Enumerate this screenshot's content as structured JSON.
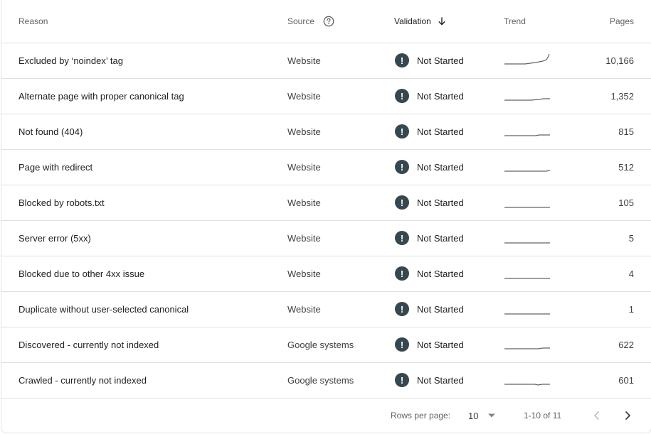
{
  "header": {
    "reason": "Reason",
    "source": "Source",
    "validation": "Validation",
    "trend": "Trend",
    "pages": "Pages"
  },
  "rows": [
    {
      "reason": "Excluded by ‘noindex’ tag",
      "source": "Website",
      "status": "Not Started",
      "pages": "10,166"
    },
    {
      "reason": "Alternate page with proper canonical tag",
      "source": "Website",
      "status": "Not Started",
      "pages": "1,352"
    },
    {
      "reason": "Not found (404)",
      "source": "Website",
      "status": "Not Started",
      "pages": "815"
    },
    {
      "reason": "Page with redirect",
      "source": "Website",
      "status": "Not Started",
      "pages": "512"
    },
    {
      "reason": "Blocked by robots.txt",
      "source": "Website",
      "status": "Not Started",
      "pages": "105"
    },
    {
      "reason": "Server error (5xx)",
      "source": "Website",
      "status": "Not Started",
      "pages": "5"
    },
    {
      "reason": "Blocked due to other 4xx issue",
      "source": "Website",
      "status": "Not Started",
      "pages": "4"
    },
    {
      "reason": "Duplicate without user-selected canonical",
      "source": "Website",
      "status": "Not Started",
      "pages": "1"
    },
    {
      "reason": "Discovered - currently not indexed",
      "source": "Google systems",
      "status": "Not Started",
      "pages": "622"
    },
    {
      "reason": "Crawled - currently not indexed",
      "source": "Google systems",
      "status": "Not Started",
      "pages": "601"
    }
  ],
  "status_icon": {
    "glyph": "!",
    "name": "exclamation-circle-icon",
    "color": "#37474f"
  },
  "footer": {
    "rows_per_page_label": "Rows per page:",
    "rows_per_page_value": "10",
    "range": "1-10 of 11"
  },
  "colors": {
    "divider": "#e0e0e0",
    "sparkline": "#5f6368",
    "status_icon_bg": "#37474f"
  }
}
